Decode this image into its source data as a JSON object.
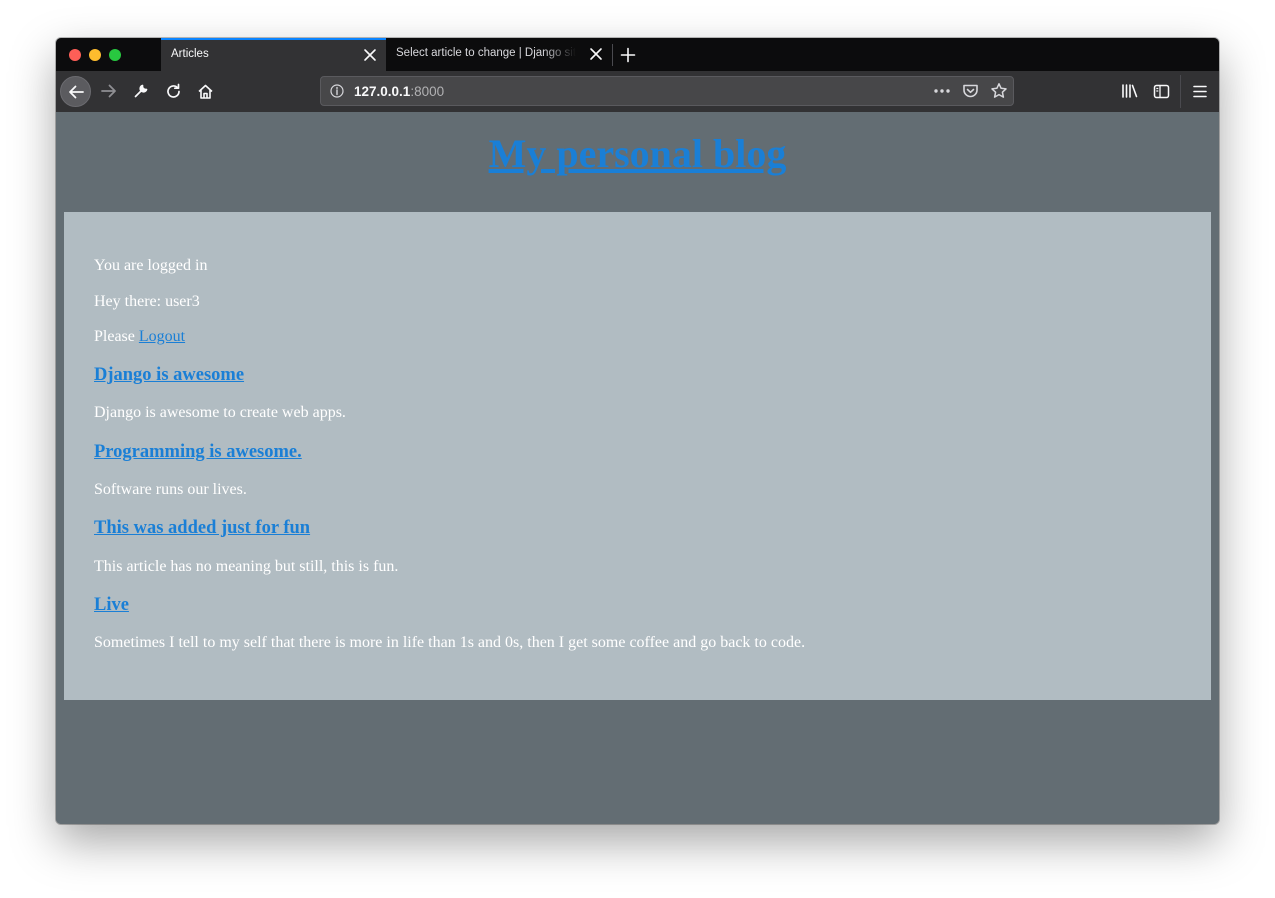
{
  "browser": {
    "tabs": [
      {
        "title": "Articles",
        "active": true
      },
      {
        "title": "Select article to change | Django site admin",
        "active": false
      }
    ],
    "url": {
      "host": "127.0.0.1",
      "port": ":8000"
    },
    "accent_color": "#0a84ff"
  },
  "page": {
    "site_title": "My personal blog",
    "logged_in_text": "You are logged in",
    "greeting": "Hey there: user3",
    "please_text": "Please ",
    "logout_label": "Logout",
    "articles": [
      {
        "title": "Django is awesome",
        "body": "Django is awesome to create web apps."
      },
      {
        "title": "Programming is awesome.",
        "body": "Software runs our lives."
      },
      {
        "title": "This was added just for fun",
        "body": "This article has no meaning but still, this is fun."
      },
      {
        "title": "Live",
        "body": "Sometimes I tell to my self that there is more in life than 1s and 0s, then I get some coffee and go back to code."
      }
    ],
    "colors": {
      "background": "#636d73",
      "content_panel": "#b1bcc2",
      "link": "#1a7fd6",
      "text": "#ffffff"
    }
  }
}
